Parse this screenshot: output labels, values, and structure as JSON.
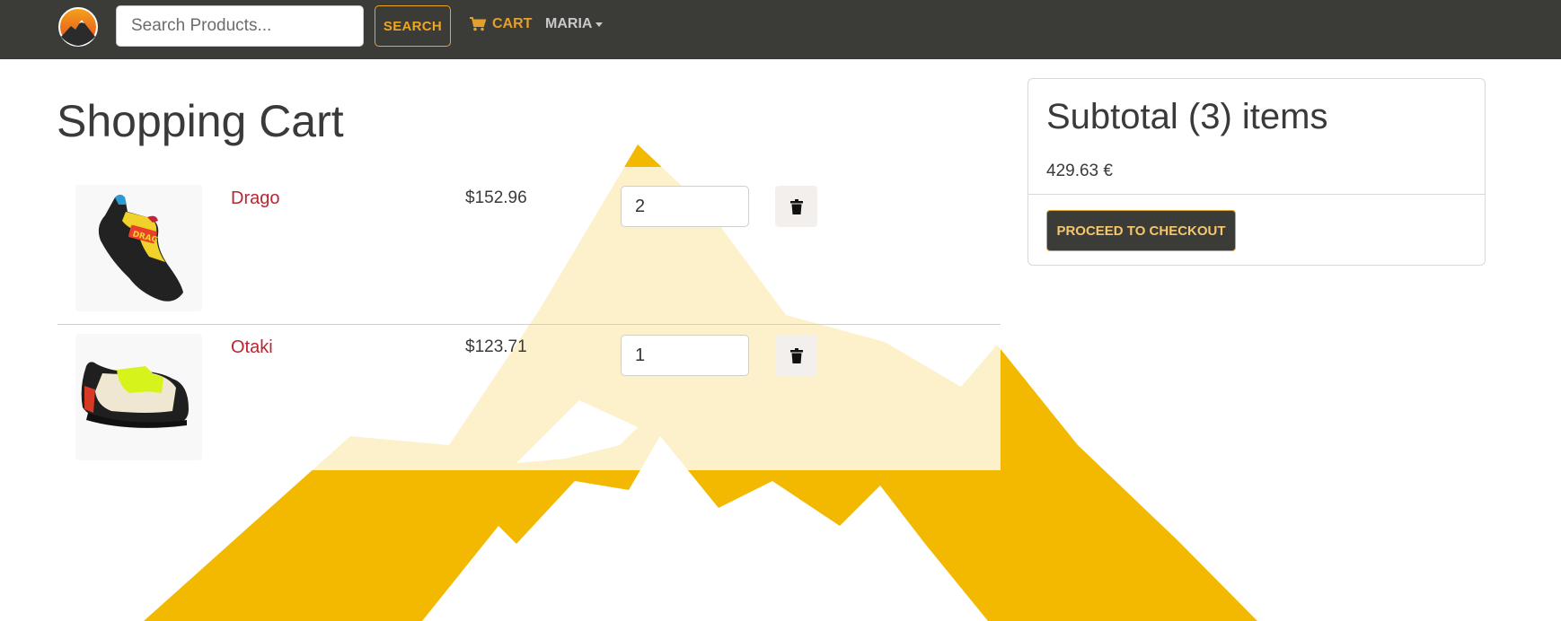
{
  "navbar": {
    "search_placeholder": "Search Products...",
    "search_button": "SEARCH",
    "cart_label": "CART",
    "user_label": "MARIA"
  },
  "page": {
    "title": "Shopping Cart"
  },
  "cart": {
    "items": [
      {
        "name": "Drago",
        "price": "$152.96",
        "quantity": "2"
      },
      {
        "name": "Otaki",
        "price": "$123.71",
        "quantity": "1"
      }
    ]
  },
  "summary": {
    "title": "Subtotal (3) items",
    "amount": "429.63 €",
    "checkout_button": "PROCEED TO CHECKOUT"
  },
  "icons": {
    "logo": "mountain-sunset-logo-icon",
    "cart": "shopping-cart-icon",
    "delete": "trash-icon",
    "dropdown": "chevron-down-icon"
  },
  "colors": {
    "navbar_bg": "#3b3b37",
    "accent_orange": "#f0a51f",
    "product_link_red": "#b82632",
    "background_mountain_yellow": "#f3b800"
  }
}
